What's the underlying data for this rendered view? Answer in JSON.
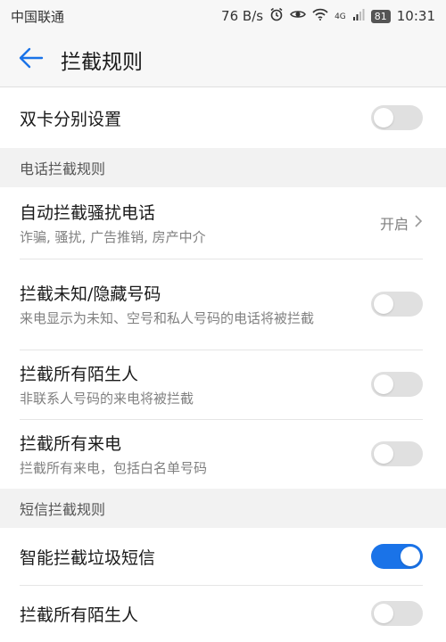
{
  "status_bar": {
    "carrier": "中国联通",
    "speed": "76 B/s",
    "network": "4G",
    "battery": "81",
    "time": "10:31"
  },
  "header": {
    "title": "拦截规则"
  },
  "dual_sim": {
    "label": "双卡分别设置",
    "enabled": false
  },
  "call_section": {
    "label": "电话拦截规则",
    "items": [
      {
        "title": "自动拦截骚扰电话",
        "subtitle": "诈骗, 骚扰, 广告推销, 房产中介",
        "value": "开启"
      },
      {
        "title": "拦截未知/隐藏号码",
        "subtitle": "来电显示为未知、空号和私人号码的电话将被拦截",
        "enabled": false
      },
      {
        "title": "拦截所有陌生人",
        "subtitle": "非联系人号码的来电将被拦截",
        "enabled": false
      },
      {
        "title": "拦截所有来电",
        "subtitle": "拦截所有来电，包括白名单号码",
        "enabled": false
      }
    ]
  },
  "sms_section": {
    "label": "短信拦截规则",
    "items": [
      {
        "title": "智能拦截垃圾短信",
        "enabled": true
      },
      {
        "title": "拦截所有陌生人",
        "enabled": false
      }
    ]
  },
  "colors": {
    "accent": "#1a73e8",
    "toggle_off": "#e0e0e0"
  }
}
